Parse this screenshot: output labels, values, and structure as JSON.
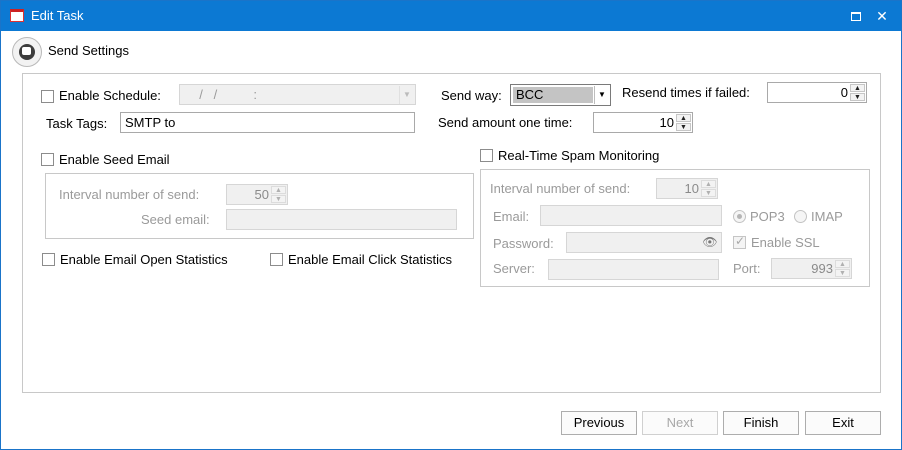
{
  "window": {
    "title": "Edit Task",
    "maximize_icon": "maximize-icon",
    "close_glyph": "✕"
  },
  "header": {
    "title": "Send Settings",
    "icon": "chat-bubble-icon"
  },
  "schedule": {
    "label": "Enable Schedule:",
    "value": "  /   /          :"
  },
  "task_tags": {
    "label": "Task Tags:",
    "value": "SMTP to"
  },
  "send_way": {
    "label": "Send way:",
    "value": "BCC"
  },
  "resend": {
    "label": "Resend times if failed:",
    "value": "0"
  },
  "send_amount": {
    "label": "Send amount one time:",
    "value": "10"
  },
  "seed": {
    "label": "Enable Seed Email",
    "interval_label": "Interval number of send:",
    "interval_value": "50",
    "seed_email_label": "Seed email:",
    "seed_email_value": ""
  },
  "stats": {
    "open_label": "Enable Email Open Statistics",
    "click_label": "Enable Email Click Statistics"
  },
  "spam": {
    "label": "Real-Time Spam Monitoring",
    "interval_label": "Interval number of send:",
    "interval_value": "10",
    "email_label": "Email:",
    "email_value": "",
    "pop3_label": "POP3",
    "imap_label": "IMAP",
    "password_label": "Password:",
    "password_value": "",
    "ssl_label": "Enable SSL",
    "server_label": "Server:",
    "server_value": "",
    "port_label": "Port:",
    "port_value": "993"
  },
  "buttons": {
    "previous": "Previous",
    "next": "Next",
    "finish": "Finish",
    "exit": "Exit"
  },
  "colors": {
    "titlebar": "#0c79d3",
    "border": "#c8c8c8",
    "disabled_text": "#9a9a9a"
  }
}
